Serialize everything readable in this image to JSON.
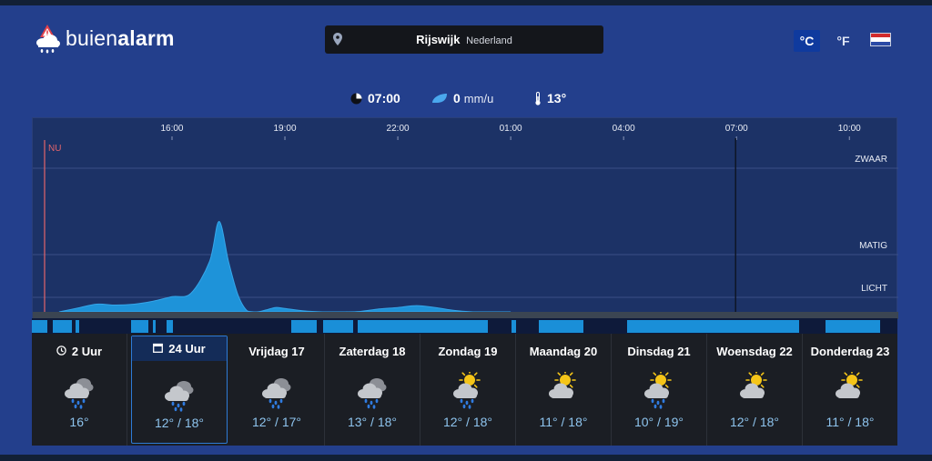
{
  "header": {
    "logo_light": "buien",
    "logo_bold": "alarm",
    "location_city": "Rijswijk",
    "location_country": "Nederland",
    "unit_celsius": "°C",
    "unit_fahrenheit": "°F",
    "flag_colors": [
      "#d22c2c",
      "#ffffff",
      "#2a4aa6"
    ]
  },
  "summary": {
    "time": "07:00",
    "rain_value": "0",
    "rain_unit": "mm/u",
    "temperature": "13°"
  },
  "chart_data": {
    "type": "area",
    "now_label": "NU",
    "x_tick_labels": [
      "16:00",
      "19:00",
      "22:00",
      "01:00",
      "04:00",
      "07:00",
      "10:00"
    ],
    "level_labels": [
      "ZWAAR",
      "MATIG",
      "LICHT"
    ],
    "level_values": [
      100,
      35,
      3
    ],
    "x_hours": [
      13.0,
      13.5,
      14.0,
      14.5,
      15.0,
      15.5,
      16.0,
      16.5,
      17.0,
      17.25,
      17.5,
      17.75,
      18.0,
      18.25,
      18.5,
      18.75,
      19.0,
      19.5,
      20.0,
      20.5,
      21.0,
      21.5,
      22.0,
      22.5,
      23.0,
      23.5,
      24.0,
      24.5,
      25.0
    ],
    "y_values": [
      0.0,
      0.8,
      1.6,
      1.4,
      1.6,
      2.2,
      3.5,
      6.0,
      30.0,
      60.0,
      30.0,
      5.0,
      0.2,
      0.0,
      0.4,
      0.9,
      0.7,
      0.2,
      0.0,
      0.0,
      0.1,
      0.6,
      0.9,
      1.3,
      0.9,
      0.3,
      0.0,
      0.0,
      0.0
    ],
    "x_range_hours": [
      12.3,
      35.3
    ],
    "selected_time_hours": 31.0,
    "y_scale": "nonlinear"
  },
  "strip_segments": [
    [
      0,
      17
    ],
    [
      23,
      44
    ],
    [
      48,
      52
    ],
    [
      109,
      128
    ],
    [
      133,
      136
    ],
    [
      148,
      155
    ],
    [
      285,
      313
    ],
    [
      320,
      353
    ],
    [
      358,
      421
    ],
    [
      421,
      501
    ],
    [
      527,
      532
    ],
    [
      557,
      606
    ],
    [
      654,
      737
    ],
    [
      737,
      843
    ],
    [
      872,
      932
    ]
  ],
  "days": [
    {
      "label": "2 Uur",
      "icon": "clock-icon",
      "weather": "cloud-rain",
      "temp": "16°",
      "active": false
    },
    {
      "label": "24 Uur",
      "icon": "calendar-icon",
      "weather": "cloud-rain",
      "temp": "12° / 18°",
      "active": true
    },
    {
      "label": "Vrijdag 17",
      "icon": "",
      "weather": "cloud-rain",
      "temp": "12° / 17°",
      "active": false
    },
    {
      "label": "Zaterdag 18",
      "icon": "",
      "weather": "cloud-rain",
      "temp": "13° / 18°",
      "active": false
    },
    {
      "label": "Zondag 19",
      "icon": "",
      "weather": "sun-cloud-rain",
      "temp": "12° / 18°",
      "active": false
    },
    {
      "label": "Maandag 20",
      "icon": "",
      "weather": "sun-cloud",
      "temp": "11° / 18°",
      "active": false
    },
    {
      "label": "Dinsdag 21",
      "icon": "",
      "weather": "sun-cloud-rain",
      "temp": "10° / 19°",
      "active": false
    },
    {
      "label": "Woensdag 22",
      "icon": "",
      "weather": "sun-cloud",
      "temp": "12° / 18°",
      "active": false
    },
    {
      "label": "Donderdag 23",
      "icon": "",
      "weather": "sun-cloud",
      "temp": "11° / 18°",
      "active": false
    }
  ],
  "colors": {
    "accent": "#1a8fd8",
    "now_line": "#e2646b",
    "temp_text": "#8ec4ee"
  }
}
